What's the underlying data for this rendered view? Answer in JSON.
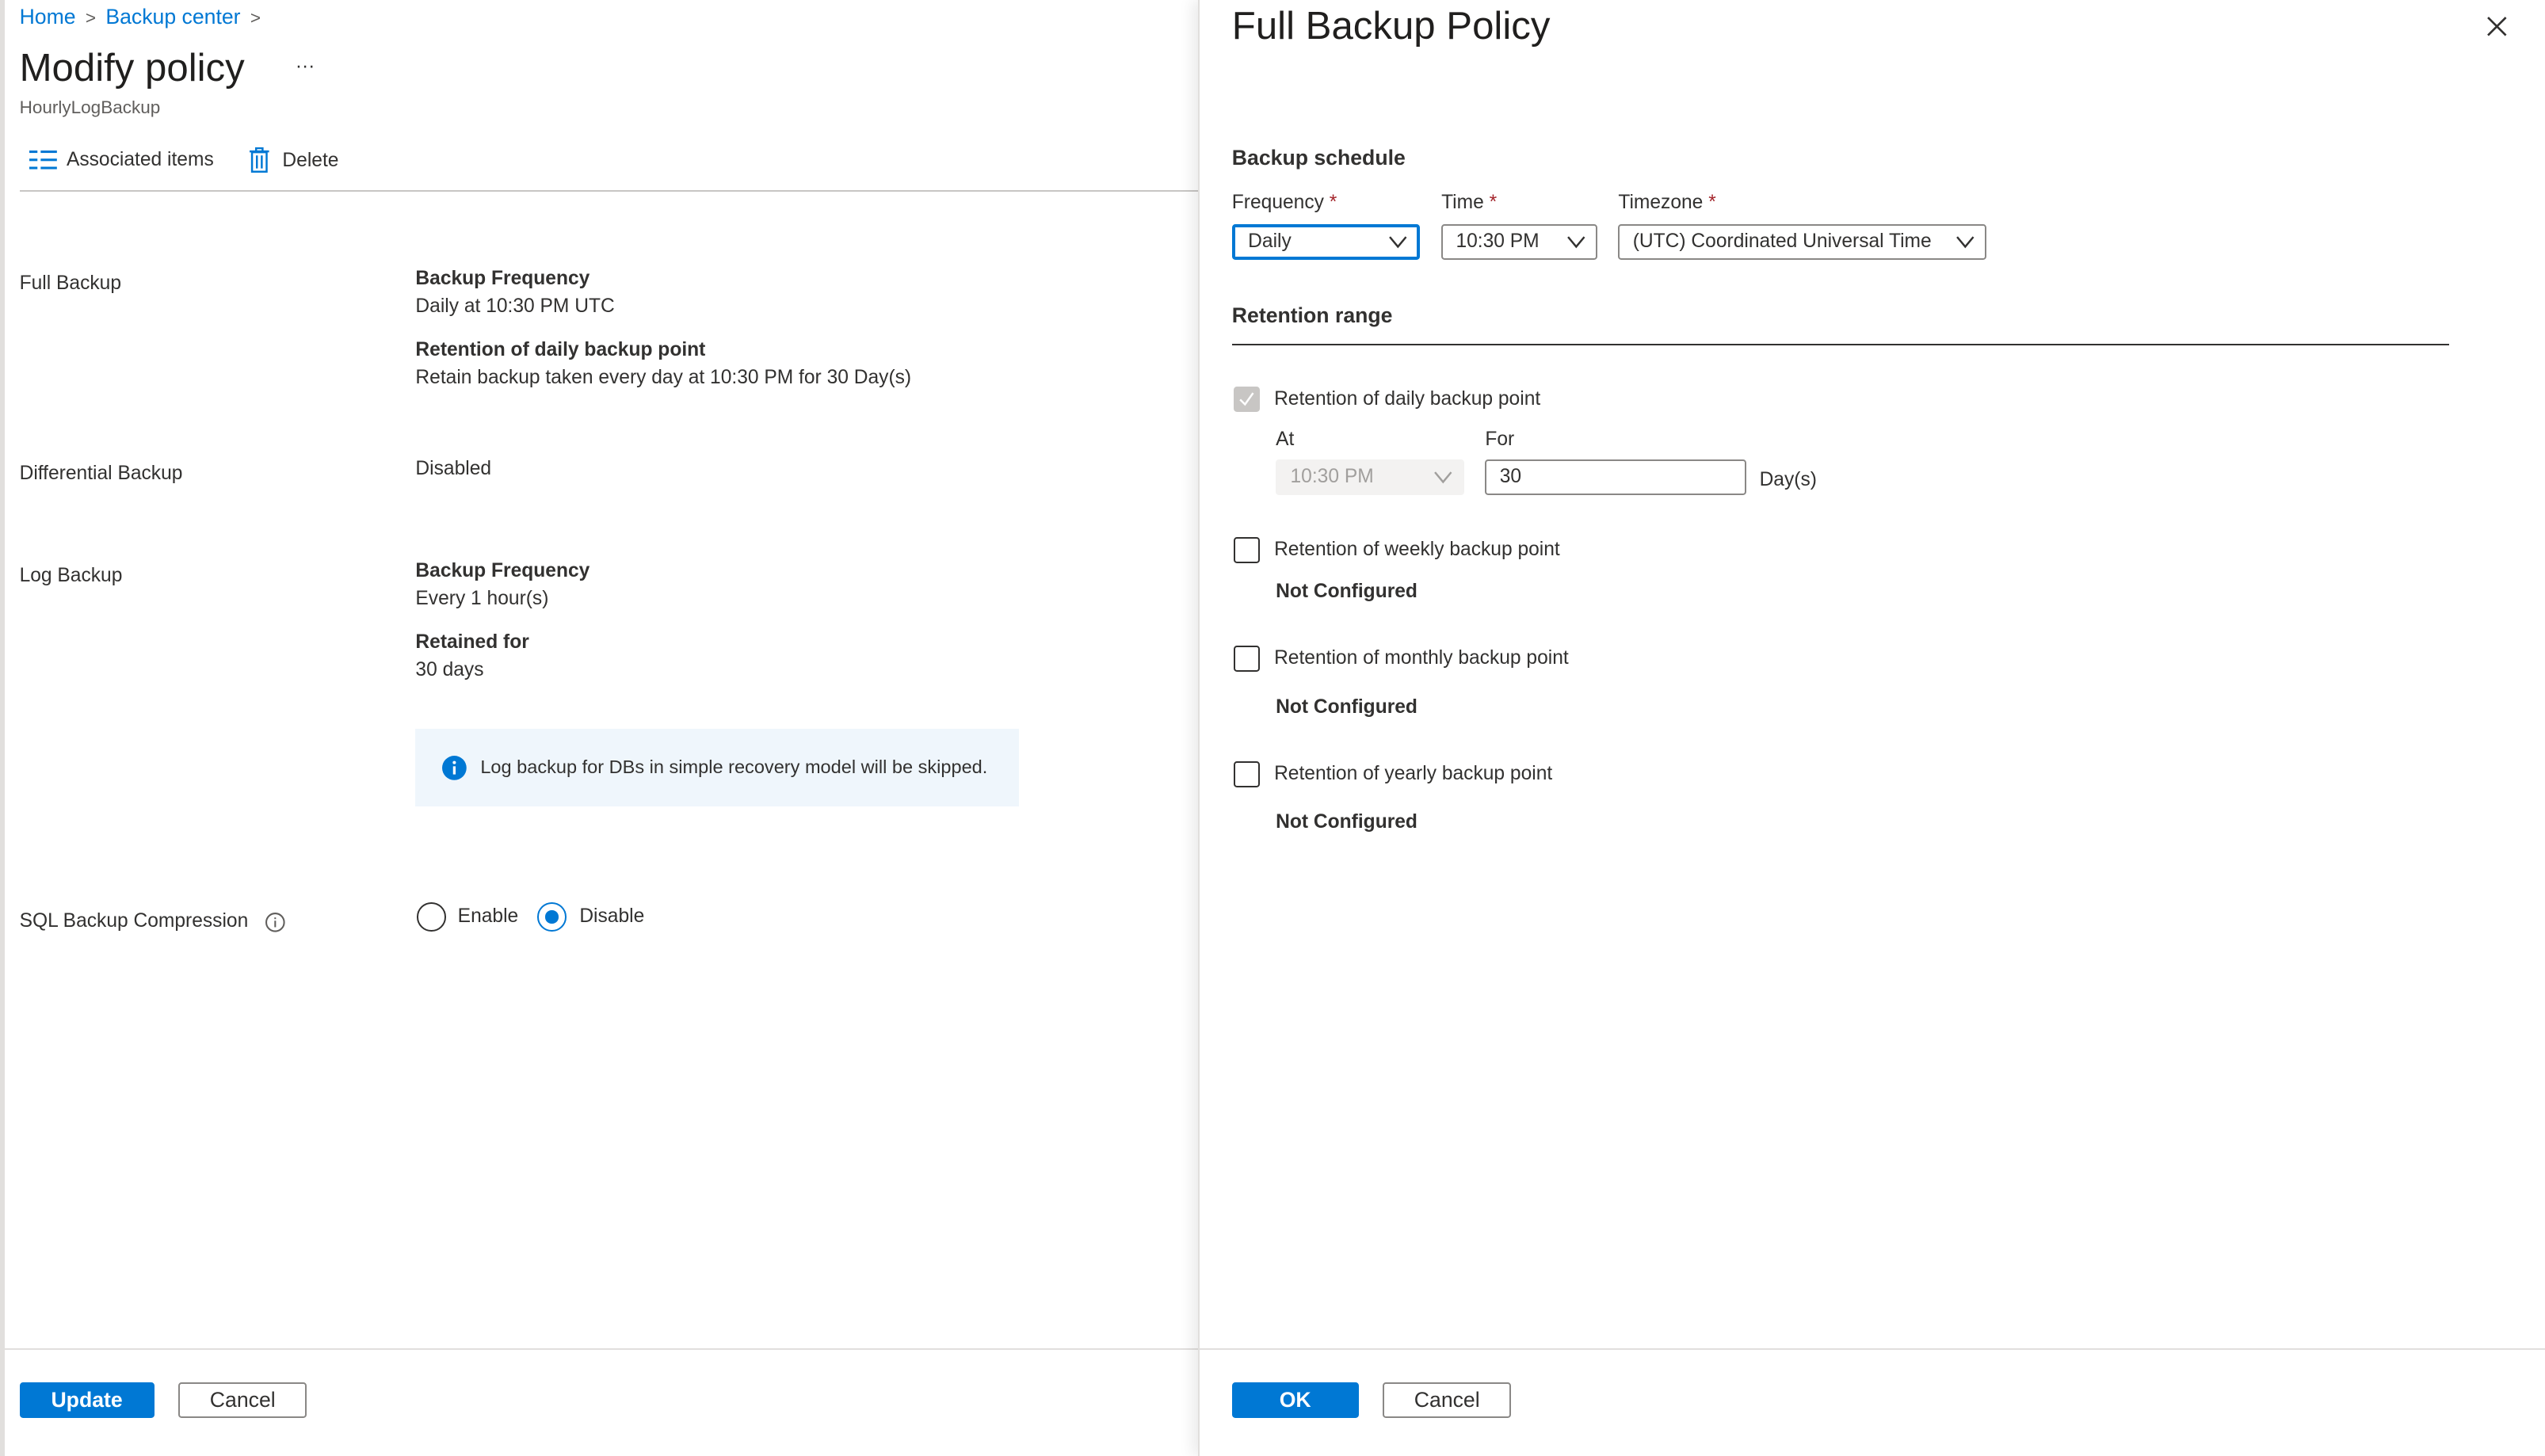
{
  "breadcrumb": {
    "items": [
      "Home",
      "Backup center"
    ]
  },
  "left": {
    "title": "Modify policy",
    "more": "···",
    "subtitle": "HourlyLogBackup",
    "toolbar": {
      "associated": "Associated items",
      "delete": "Delete"
    },
    "full": {
      "label": "Full Backup",
      "freq_h": "Backup Frequency",
      "freq_v": "Daily at 10:30 PM UTC",
      "ret_h": "Retention of daily backup point",
      "ret_v": "Retain backup taken every day at 10:30 PM for 30 Day(s)"
    },
    "diff": {
      "label": "Differential Backup",
      "value": "Disabled"
    },
    "log": {
      "label": "Log Backup",
      "freq_h": "Backup Frequency",
      "freq_v": "Every 1 hour(s)",
      "ret_h": "Retained for",
      "ret_v": "30 days",
      "info": "Log backup for DBs in simple recovery model will be skipped."
    },
    "compression": {
      "label": "SQL Backup Compression",
      "enable": "Enable",
      "disable": "Disable",
      "selected": "Disable"
    },
    "update": "Update",
    "cancel": "Cancel"
  },
  "right": {
    "title": "Full Backup Policy",
    "schedule": "Backup schedule",
    "frequency": {
      "label": "Frequency",
      "value": "Daily"
    },
    "time": {
      "label": "Time",
      "value": "10:30 PM"
    },
    "timezone": {
      "label": "Timezone",
      "value": "(UTC) Coordinated Universal Time"
    },
    "required": "*",
    "retention": "Retention range",
    "daily": {
      "label": "Retention of daily backup point",
      "checked": true,
      "at_label": "At",
      "at_value": "10:30 PM",
      "for_label": "For",
      "for_value": "30",
      "unit": "Day(s)"
    },
    "weekly": {
      "label": "Retention of weekly backup point",
      "status": "Not Configured"
    },
    "monthly": {
      "label": "Retention of monthly backup point",
      "status": "Not Configured"
    },
    "yearly": {
      "label": "Retention of yearly backup point",
      "status": "Not Configured"
    },
    "ok": "OK",
    "cancel": "Cancel"
  },
  "colors": {
    "accent": "#0078d4",
    "info_bg": "#eff6fc",
    "required": "#a4262c"
  }
}
